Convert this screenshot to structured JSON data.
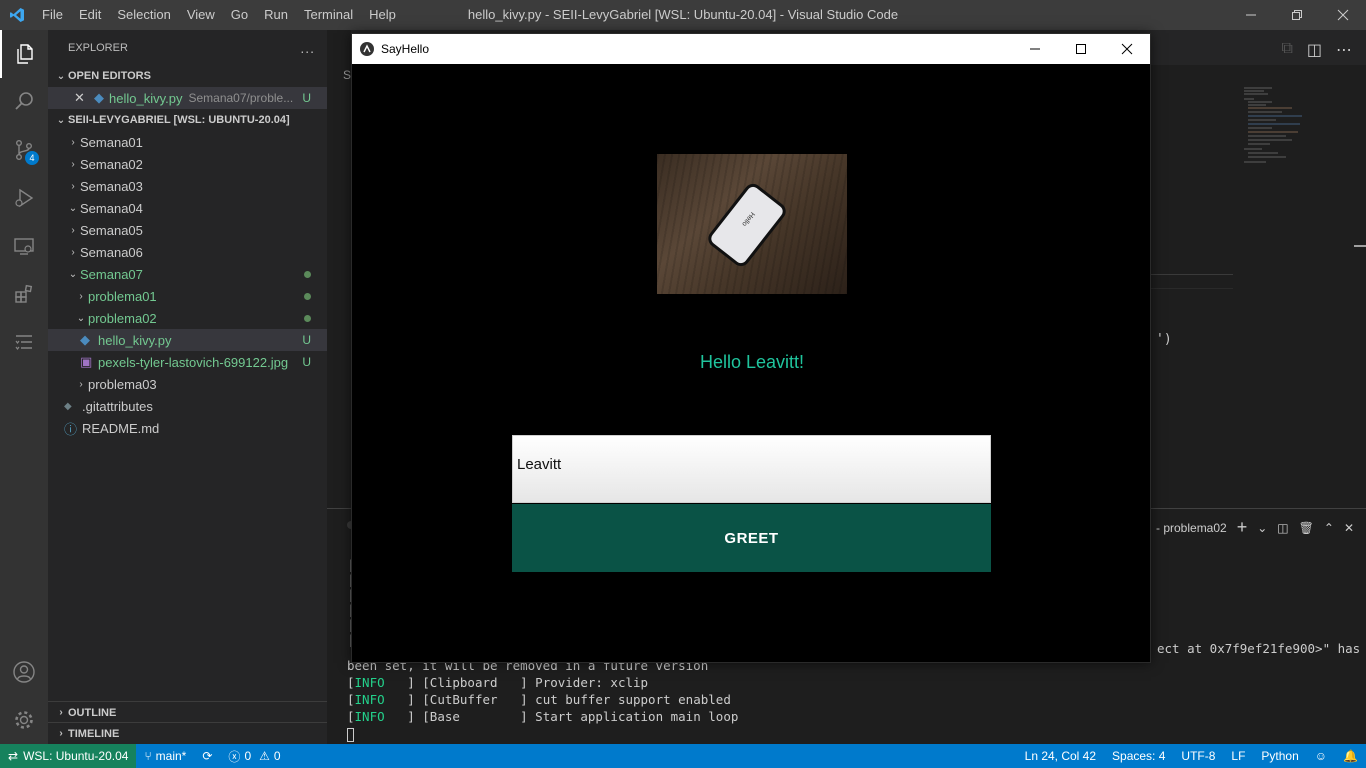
{
  "titlebar": {
    "menus": [
      "File",
      "Edit",
      "Selection",
      "View",
      "Go",
      "Run",
      "Terminal",
      "Help"
    ],
    "title": "hello_kivy.py - SEII-LevyGabriel [WSL: Ubuntu-20.04] - Visual Studio Code"
  },
  "activity": {
    "scm_badge": "4"
  },
  "sidebar": {
    "title": "EXPLORER",
    "more": "...",
    "open_editors_label": "OPEN EDITORS",
    "open_editor": {
      "name": "hello_kivy.py",
      "path": "Semana07/proble...",
      "status": "U"
    },
    "workspace_label": "SEII-LEVYGABRIEL [WSL: UBUNTU-20.04]",
    "tree": [
      {
        "name": "Semana01"
      },
      {
        "name": "Semana02"
      },
      {
        "name": "Semana03"
      },
      {
        "name": "Semana04"
      },
      {
        "name": "Semana05"
      },
      {
        "name": "Semana06"
      },
      {
        "name": "Semana07"
      },
      {
        "name": "problema01"
      },
      {
        "name": "problema02"
      },
      {
        "name": "hello_kivy.py",
        "status": "U"
      },
      {
        "name": "pexels-tyler-lastovich-699122.jpg",
        "status": "U"
      },
      {
        "name": "problema03"
      },
      {
        "name": ".gitattributes"
      },
      {
        "name": "README.md"
      }
    ],
    "outline_label": "OUTLINE",
    "timeline_label": "TIMELINE"
  },
  "editor": {
    "tab_fragment": "S",
    "code_fragment": "')",
    "panel_title": "- problema02"
  },
  "terminal": {
    "tail_1": "ect at 0x7f9ef21fe900>\" has",
    "tail_2": "been set, it will be removed in a future version",
    "lines": [
      {
        "level": "INFO",
        "source": "[Clipboard   ]",
        "message": "Provider: xclip"
      },
      {
        "level": "INFO",
        "source": "[CutBuffer   ]",
        "message": "cut buffer support enabled"
      },
      {
        "level": "INFO",
        "source": "[Base        ]",
        "message": "Start application main loop"
      }
    ]
  },
  "statusbar": {
    "remote": "WSL: Ubuntu-20.04",
    "branch": "main*",
    "errors": "0",
    "warnings": "0",
    "position": "Ln 24, Col 42",
    "spaces": "Spaces: 4",
    "encoding": "UTF-8",
    "eol": "LF",
    "language": "Python"
  },
  "kivy_window": {
    "title": "SayHello",
    "phone_text": "Hello",
    "greeting": "Hello Leavitt!",
    "input_value": "Leavitt",
    "button_label": "GREET"
  },
  "colors": {
    "accent": "#007acc",
    "remote": "#16825d",
    "greeting": "#1fc49d",
    "button": "#0a5346",
    "git_untracked": "#73c991"
  }
}
